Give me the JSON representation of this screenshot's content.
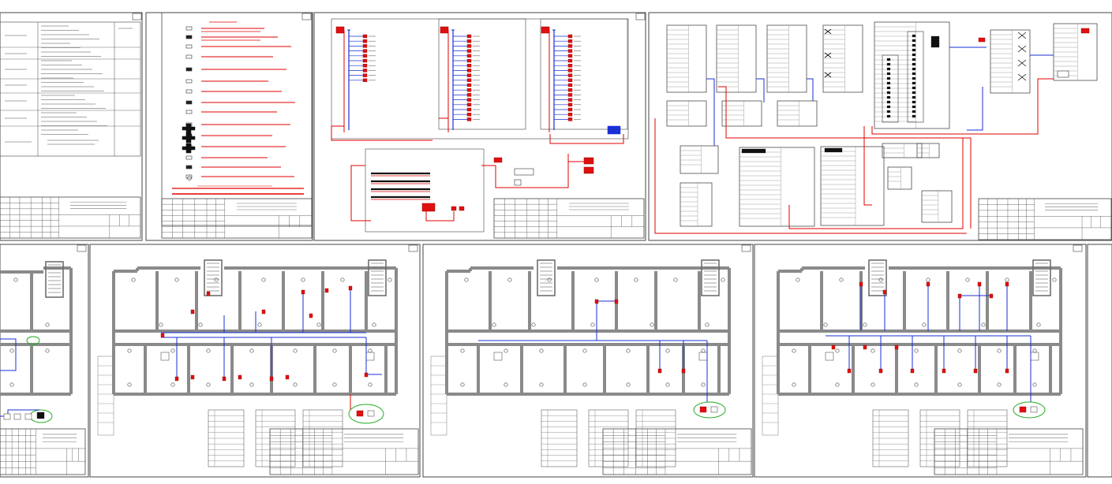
{
  "sheets": [
    {
      "id": "sheet-1",
      "kind": "general-data",
      "number": ""
    },
    {
      "id": "sheet-2",
      "kind": "legend",
      "number": ""
    },
    {
      "id": "sheet-3",
      "kind": "structural-scheme",
      "number": ""
    },
    {
      "id": "sheet-4",
      "kind": "block-scheme",
      "number": ""
    },
    {
      "id": "sheet-5",
      "kind": "floor-plan",
      "number": ""
    },
    {
      "id": "sheet-6",
      "kind": "floor-plan",
      "number": ""
    },
    {
      "id": "sheet-7",
      "kind": "floor-plan",
      "number": ""
    },
    {
      "id": "sheet-8",
      "kind": "floor-plan",
      "number": ""
    }
  ],
  "colors": {
    "frame": "#444444",
    "wall": "#8a8a8a",
    "red_line": "#e00000",
    "blue_line": "#1a2fd6",
    "green_mark": "#22aa22",
    "device_red": "#e01010",
    "text": "#222222"
  }
}
